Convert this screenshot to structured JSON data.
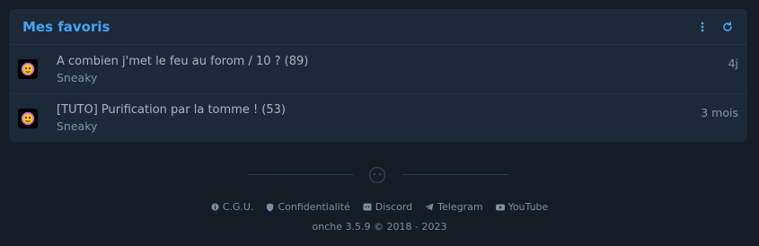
{
  "favorites": {
    "title": "Mes favoris",
    "items": [
      {
        "title": "A combien j'met le feu au forom / 10 ? (89)",
        "author": "Sneaky",
        "time": "4j"
      },
      {
        "title": "[TUTO] Purification par la tomme ! (53)",
        "author": "Sneaky",
        "time": "3 mois"
      }
    ]
  },
  "footer": {
    "links": [
      {
        "label": "C.G.U.",
        "icon": "info-icon"
      },
      {
        "label": "Confidentialité",
        "icon": "shield-icon"
      },
      {
        "label": "Discord",
        "icon": "discord-icon"
      },
      {
        "label": "Telegram",
        "icon": "telegram-icon"
      },
      {
        "label": "YouTube",
        "icon": "youtube-icon"
      }
    ],
    "copyright": "onche 3.5.9 © 2018 - 2023"
  },
  "colors": {
    "background": "#141c26",
    "panel": "#1c2938",
    "accent": "#4aa3f2",
    "muted_text": "#7d8ea3"
  }
}
